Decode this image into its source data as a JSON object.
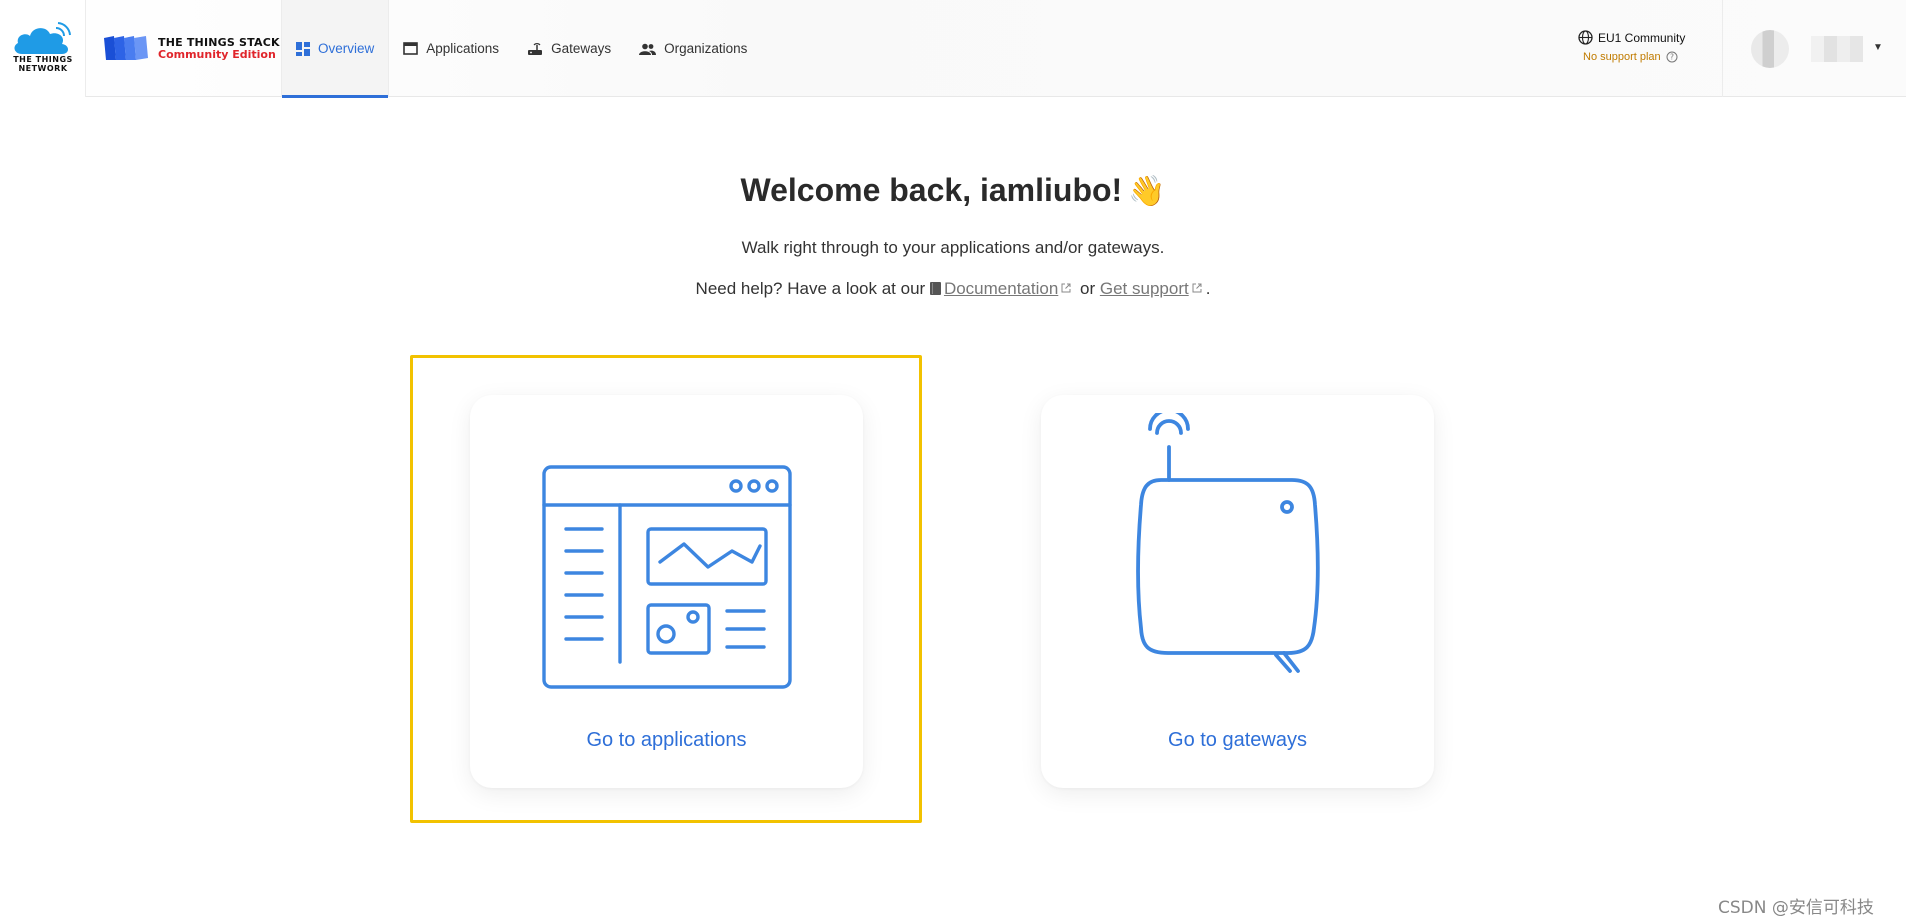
{
  "header": {
    "ttn_logo_text": "THE THINGS\nNETWORK",
    "product_title": "THE THINGS STACK",
    "product_subtitle": "Community Edition",
    "nav": [
      {
        "label": "Overview",
        "icon": "grid-icon",
        "active": true
      },
      {
        "label": "Applications",
        "icon": "window-icon",
        "active": false
      },
      {
        "label": "Gateways",
        "icon": "router-icon",
        "active": false
      },
      {
        "label": "Organizations",
        "icon": "people-icon",
        "active": false
      }
    ],
    "cluster": "EU1 Community",
    "support_plan": "No support plan"
  },
  "main": {
    "welcome_title": "Welcome back, iamliubo!",
    "welcome_emoji": "👋",
    "subtitle": "Walk right through to your applications and/or gateways.",
    "help_prefix": "Need help? Have a look at our",
    "documentation_link": "Documentation",
    "help_or": "or",
    "support_link": "Get support",
    "help_suffix": ".",
    "cards": {
      "applications_label": "Go to applications",
      "gateways_label": "Go to gateways"
    }
  },
  "watermark": "CSDN @安信可科技",
  "colors": {
    "accent": "#2e6fd8",
    "highlight": "#f2c200",
    "support_plan": "#c07b00",
    "brand_red": "#e0252b"
  }
}
